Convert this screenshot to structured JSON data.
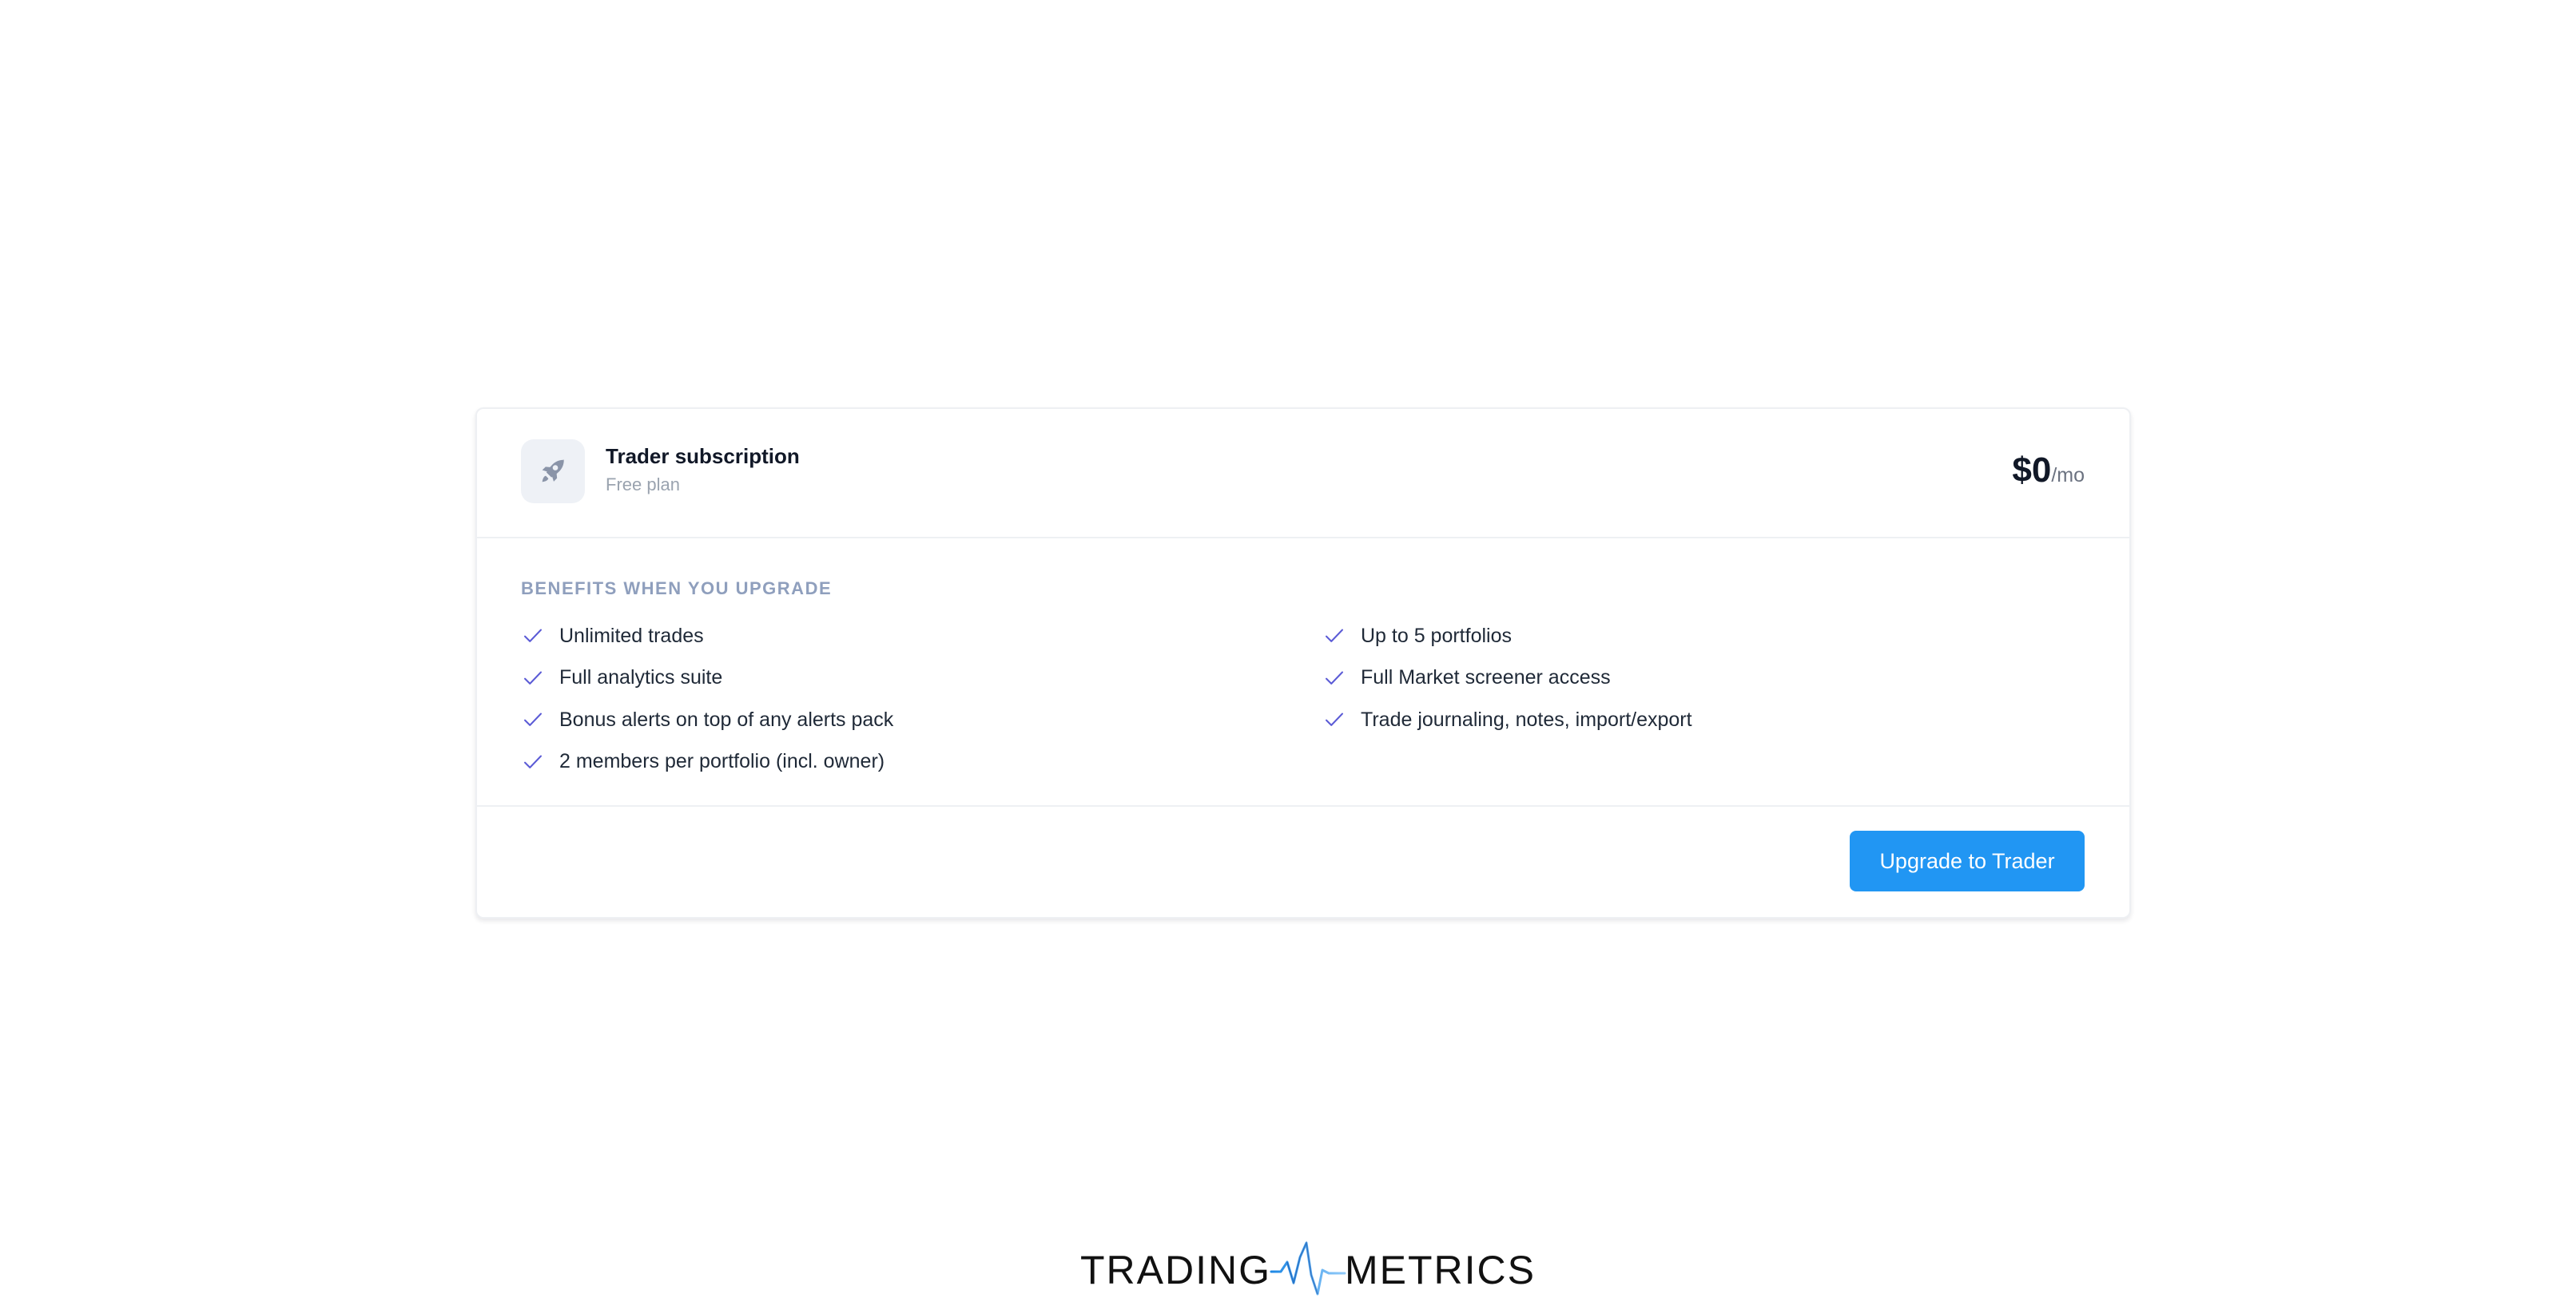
{
  "plan": {
    "icon": "rocket-icon",
    "title": "Trader subscription",
    "subtitle": "Free plan",
    "price_amount": "$0",
    "price_period": "/mo"
  },
  "benefits": {
    "heading": "BENEFITS WHEN YOU UPGRADE",
    "check_icon": "check-icon",
    "left": [
      "Unlimited trades",
      "Full analytics suite",
      "Bonus alerts on top of any alerts pack",
      "2 members per portfolio (incl. owner)"
    ],
    "right": [
      "Up to 5 portfolios",
      "Full Market screener access",
      "Trade journaling, notes, import/export"
    ]
  },
  "footer": {
    "upgrade_label": "Upgrade to Trader"
  },
  "brand": {
    "left_word": "TRADING",
    "right_word": "METRICS"
  },
  "colors": {
    "accent": "#2196f3",
    "check": "#5b5bd6",
    "heading": "#8f9fbd",
    "muted": "#9aa3af"
  }
}
